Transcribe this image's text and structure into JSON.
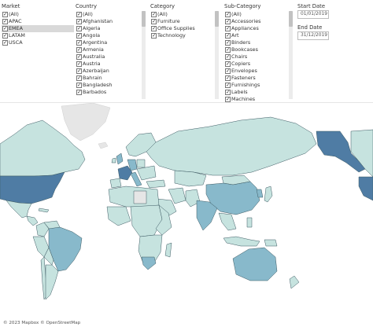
{
  "filters": {
    "market": {
      "title": "Market",
      "options": [
        {
          "label": "(All)",
          "checked": true
        },
        {
          "label": "APAC",
          "checked": true
        },
        {
          "label": "EMEA",
          "checked": true
        },
        {
          "label": "LATAM",
          "checked": true
        },
        {
          "label": "USCA",
          "checked": true
        }
      ]
    },
    "country": {
      "title": "Country",
      "options": [
        {
          "label": "(All)",
          "checked": true
        },
        {
          "label": "Afghanistan",
          "checked": true
        },
        {
          "label": "Algeria",
          "checked": true
        },
        {
          "label": "Angola",
          "checked": true
        },
        {
          "label": "Argentina",
          "checked": true
        },
        {
          "label": "Armenia",
          "checked": true
        },
        {
          "label": "Australia",
          "checked": true
        },
        {
          "label": "Austria",
          "checked": true
        },
        {
          "label": "Azerbaijan",
          "checked": true
        },
        {
          "label": "Bahrain",
          "checked": true
        },
        {
          "label": "Bangladesh",
          "checked": true
        },
        {
          "label": "Barbados",
          "checked": true
        }
      ]
    },
    "category": {
      "title": "Category",
      "options": [
        {
          "label": "(All)",
          "checked": true
        },
        {
          "label": "Furniture",
          "checked": true
        },
        {
          "label": "Office Supplies",
          "checked": true
        },
        {
          "label": "Technology",
          "checked": true
        }
      ]
    },
    "subcategory": {
      "title": "Sub-Category",
      "options": [
        {
          "label": "(All)",
          "checked": true
        },
        {
          "label": "Accessories",
          "checked": true
        },
        {
          "label": "Appliances",
          "checked": true
        },
        {
          "label": "Art",
          "checked": true
        },
        {
          "label": "Binders",
          "checked": true
        },
        {
          "label": "Bookcases",
          "checked": true
        },
        {
          "label": "Chairs",
          "checked": true
        },
        {
          "label": "Copiers",
          "checked": true
        },
        {
          "label": "Envelopes",
          "checked": true
        },
        {
          "label": "Fasteners",
          "checked": true
        },
        {
          "label": "Furnishings",
          "checked": true
        },
        {
          "label": "Labels",
          "checked": true
        },
        {
          "label": "Machines",
          "checked": true
        }
      ]
    }
  },
  "dates": {
    "start_label": "Start Date",
    "start_value": "01/01/2019",
    "end_label": "End Date",
    "end_value": "31/12/2019"
  },
  "map": {
    "attribution": "© 2023 Mapbox © OpenStreetMap",
    "colors": {
      "light": "#c6e3df",
      "medium": "#88b9cb",
      "dark": "#4f7ca4",
      "no_data": "#e6e6e6",
      "border": "#3d5a63"
    }
  }
}
